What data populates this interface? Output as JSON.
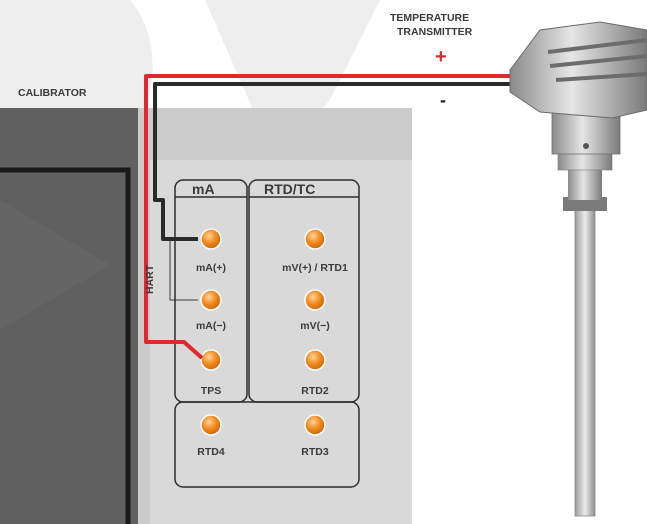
{
  "labels": {
    "calibrator": "CALIBRATOR",
    "transmitter_line1": "TEMPERATURE",
    "transmitter_line2": "TRANSMITTER",
    "plus": "+",
    "minus": "-",
    "hart": "HART"
  },
  "panel": {
    "ma_header": "mA",
    "rtd_header": "RTD/TC",
    "terminals": {
      "ma_plus": "mA(+)",
      "ma_minus": "mA(−)",
      "tps": "TPS",
      "rtd4": "RTD4",
      "mv_plus_rtd1": "mV(+) / RTD1",
      "mv_minus": "mV(−)",
      "rtd2": "RTD2",
      "rtd3": "RTD3"
    }
  },
  "colors": {
    "positive_wire": "#e0282d",
    "negative_wire": "#2a2a2a",
    "terminal_fill": "#f28a1e",
    "panel_bg": "#d7d7d7",
    "calibrator_bg": "#cbcbcb"
  }
}
